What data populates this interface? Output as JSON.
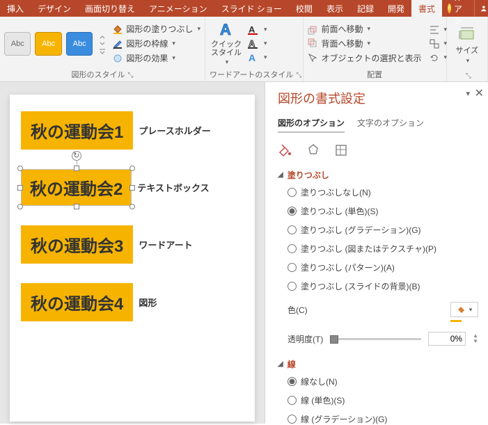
{
  "tabs": {
    "items": [
      "挿入",
      "デザイン",
      "画面切り替え",
      "アニメーション",
      "スライド ショー",
      "校閲",
      "表示",
      "記録",
      "開発",
      "書式"
    ],
    "active": 9,
    "tell_me": "操作アシス",
    "share": "共有"
  },
  "ribbon": {
    "shape_styles": {
      "label": "図形のスタイル",
      "sample_text": "Abc",
      "fill": "図形の塗りつぶし",
      "outline": "図形の枠線",
      "effects": "図形の効果"
    },
    "wordart": {
      "label": "ワードアートのスタイル",
      "quick": "クイック\nスタイル"
    },
    "arrange": {
      "label": "配置",
      "front": "前面へ移動",
      "back": "背面へ移動",
      "selection": "オブジェクトの選択と表示"
    },
    "size": {
      "label": "サイズ"
    }
  },
  "slide": {
    "shapes": [
      {
        "text": "秋の運動会1",
        "label": "プレースホルダー",
        "selected": false
      },
      {
        "text": "秋の運動会2",
        "label": "テキストボックス",
        "selected": true
      },
      {
        "text": "秋の運動会3",
        "label": "ワードアート",
        "selected": false
      },
      {
        "text": "秋の運動会4",
        "label": "図形",
        "selected": false
      }
    ]
  },
  "pane": {
    "title": "図形の書式設定",
    "tab_shape": "図形のオプション",
    "tab_text": "文字のオプション",
    "fill_section": "塗りつぶし",
    "fill_options": [
      "塗りつぶしなし(N)",
      "塗りつぶし (単色)(S)",
      "塗りつぶし (グラデーション)(G)",
      "塗りつぶし (図またはテクスチャ)(P)",
      "塗りつぶし (パターン)(A)",
      "塗りつぶし (スライドの背景)(B)"
    ],
    "fill_selected": 1,
    "color_label": "色(C)",
    "trans_label": "透明度(T)",
    "trans_value": "0%",
    "line_section": "線",
    "line_options": [
      "線なし(N)",
      "線 (単色)(S)",
      "線 (グラデーション)(G)"
    ],
    "line_selected": 0
  }
}
